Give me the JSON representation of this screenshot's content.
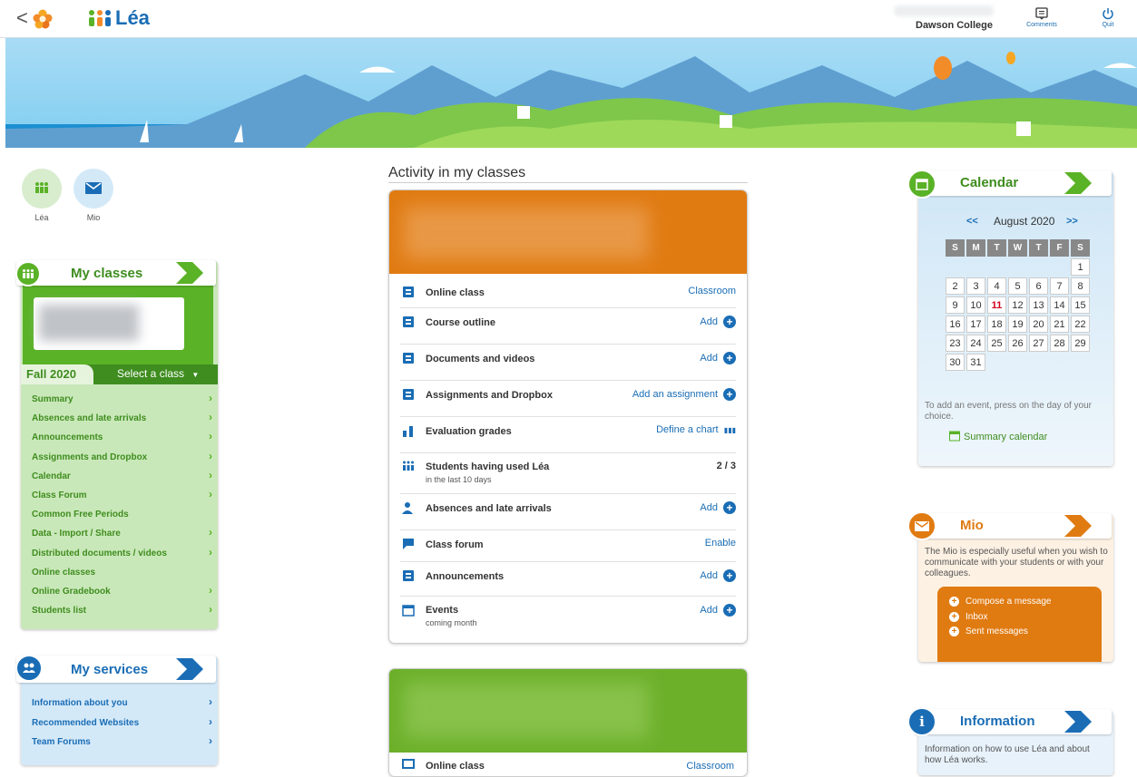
{
  "topbar": {
    "back_label": "<",
    "app_name": "Léa",
    "college": "Dawson College",
    "comments_label": "Comments",
    "quit_label": "Quit"
  },
  "shortcuts": [
    {
      "label": "Léa"
    },
    {
      "label": "Mio"
    }
  ],
  "my_classes": {
    "title": "My classes",
    "term": "Fall 2020",
    "select_label": "Select a class",
    "items": [
      "Summary",
      "Absences and late arrivals",
      "Announcements",
      "Assignments and Dropbox",
      "Calendar",
      "Class Forum",
      "Common Free Periods",
      "Data - Import / Share",
      "Distributed documents / videos",
      "Online classes",
      "Online Gradebook",
      "Students list"
    ]
  },
  "my_services": {
    "title": "My services",
    "items": [
      "Information about you",
      "Recommended Websites",
      "Team Forums"
    ]
  },
  "activity": {
    "title": "Activity in my classes",
    "rows": [
      {
        "label": "Online class",
        "action": "Classroom",
        "sub": ""
      },
      {
        "label": "Course outline",
        "action": "Add",
        "sub": ""
      },
      {
        "label": "Documents and videos",
        "action": "Add",
        "sub": ""
      },
      {
        "label": "Assignments and Dropbox",
        "action": "Add an assignment",
        "sub": ""
      },
      {
        "label": "Evaluation grades",
        "action": "Define a chart",
        "sub": ""
      },
      {
        "label": "Students having used Léa",
        "action": "2 / 3",
        "sub": "in the last 10 days"
      },
      {
        "label": "Absences and late arrivals",
        "action": "Add",
        "sub": ""
      },
      {
        "label": "Class forum",
        "action": "Enable",
        "sub": ""
      },
      {
        "label": "Announcements",
        "action": "Add",
        "sub": ""
      },
      {
        "label": "Events",
        "action": "Add",
        "sub": "coming month"
      }
    ],
    "second_card_row": {
      "label": "Online class",
      "action": "Classroom"
    }
  },
  "calendar": {
    "title": "Calendar",
    "prev": "<<",
    "next": ">>",
    "month": "August 2020",
    "days": [
      "S",
      "M",
      "T",
      "W",
      "T",
      "F",
      "S"
    ],
    "weeks": [
      [
        "",
        "",
        "",
        "",
        "",
        "",
        "1"
      ],
      [
        "2",
        "3",
        "4",
        "5",
        "6",
        "7",
        "8"
      ],
      [
        "9",
        "10",
        "11",
        "12",
        "13",
        "14",
        "15"
      ],
      [
        "16",
        "17",
        "18",
        "19",
        "20",
        "21",
        "22"
      ],
      [
        "23",
        "24",
        "25",
        "26",
        "27",
        "28",
        "29"
      ],
      [
        "30",
        "31",
        "",
        "",
        "",
        "",
        ""
      ]
    ],
    "today": "11",
    "hint": "To add an event, press on the day of your choice.",
    "summary_link": "Summary calendar"
  },
  "mio": {
    "title": "Mio",
    "description": "The Mio is especially useful when you wish to communicate with your students or with your colleagues.",
    "actions": [
      "Compose a message",
      "Inbox",
      "Sent messages"
    ]
  },
  "information": {
    "title": "Information",
    "description": "Information on how to use Léa and about how Léa works."
  },
  "colors": {
    "blue": "#1a6db5",
    "green": "#5ab227",
    "orange": "#e07b12",
    "light_green": "#c9e8b9",
    "light_blue": "#d4e9f8"
  }
}
